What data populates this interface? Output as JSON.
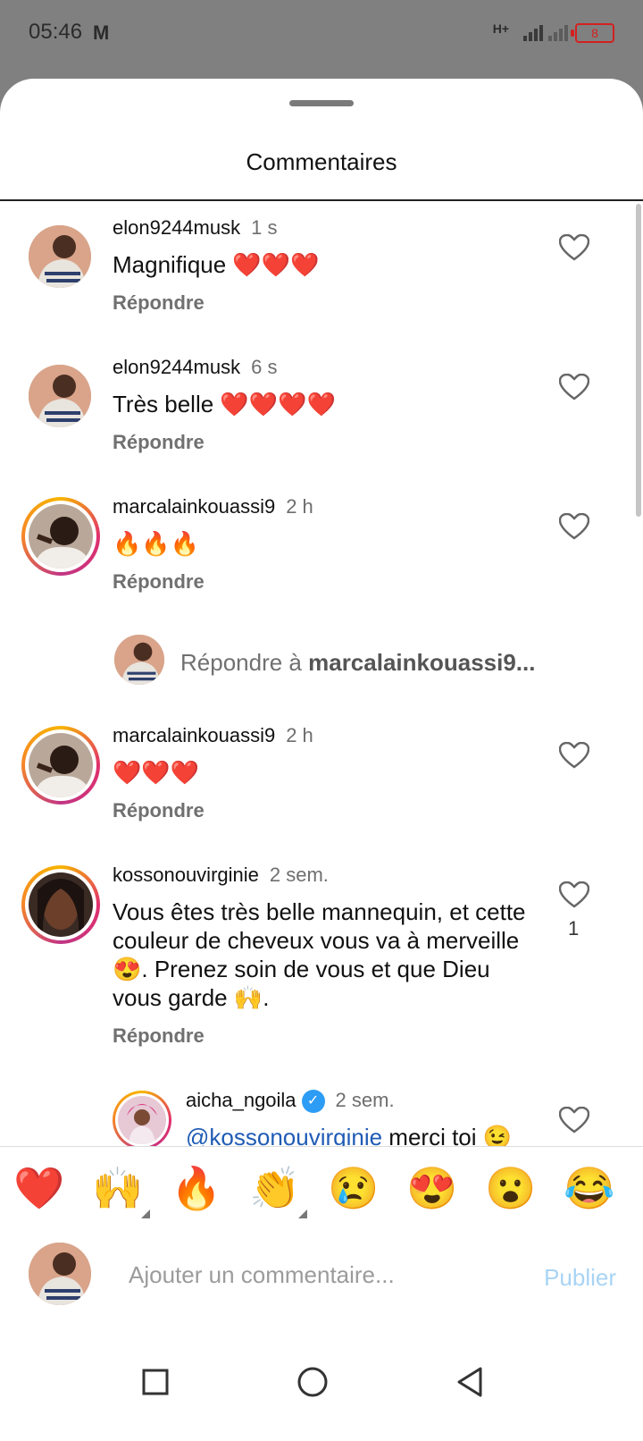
{
  "status": {
    "time": "05:46",
    "mail_icon": "gmail-icon",
    "network": "H+",
    "battery": "8"
  },
  "sheet": {
    "title": "Commentaires"
  },
  "comments": [
    {
      "user": "elon9244musk",
      "time": "1 s",
      "text": "Magnifique ❤️❤️❤️",
      "reply": "Répondre"
    },
    {
      "user": "elon9244musk",
      "time": "6 s",
      "text": "Très belle ❤️❤️❤️❤️",
      "reply": "Répondre"
    },
    {
      "user": "marcalainkouassi9",
      "time": "2 h",
      "text": "🔥🔥🔥",
      "reply": "Répondre"
    },
    {
      "user": "marcalainkouassi9",
      "time": "2 h",
      "text": "❤️❤️❤️",
      "reply": "Répondre"
    },
    {
      "user": "kossonouvirginie",
      "time": "2 sem.",
      "text": "Vous êtes très belle mannequin, et cette couleur de cheveux vous va à merveille 😍. Prenez soin de vous et que Dieu vous garde 🙌.",
      "reply": "Répondre",
      "likes": "1"
    },
    {
      "user": "aicha_ngoila",
      "time": "2 sem.",
      "mention": "@kossonouvirginie",
      "text": " merci toi 😉"
    }
  ],
  "reply_prompt": {
    "prefix": "Répondre à ",
    "target": "marcalainkouassi9..."
  },
  "emoji_bar": [
    "❤️",
    "🙌",
    "🔥",
    "👏",
    "😢",
    "😍",
    "😮",
    "😂"
  ],
  "compose": {
    "placeholder": "Ajouter un commentaire...",
    "publish": "Publier"
  },
  "colors": {
    "accent_blue": "#a8d4f5",
    "mention": "#1f5bb5",
    "heart_red": "#e0202a"
  }
}
